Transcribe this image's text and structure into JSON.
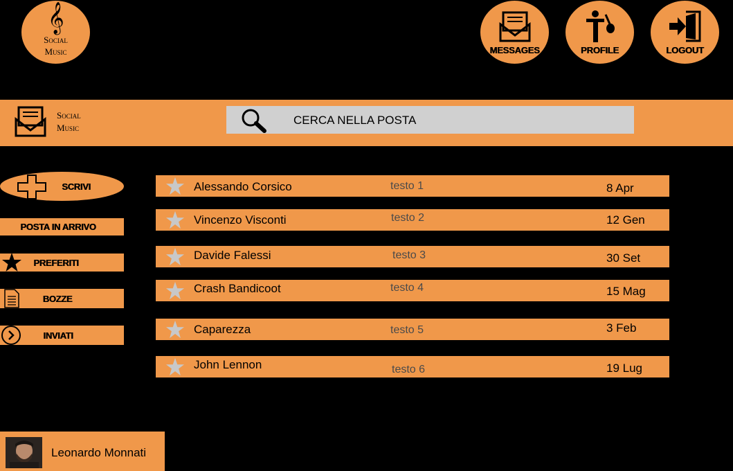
{
  "brand": {
    "line1": "Social",
    "line2": "Music",
    "logo_icon": "treble-clef-icon"
  },
  "top_nav": [
    {
      "label": "MESSAGES",
      "icon": "envelope-icon"
    },
    {
      "label": "PROFILE",
      "icon": "musician-icon"
    },
    {
      "label": "LOGOUT",
      "icon": "logout-door-icon"
    }
  ],
  "mail_bar": {
    "brand_line1": "Social",
    "brand_line2": "Music",
    "search_text": "CERCA NELLA POSTA"
  },
  "sidebar": {
    "compose": "SCRIVI",
    "items": [
      {
        "label": "POSTA IN ARRIVO",
        "icon": ""
      },
      {
        "label": "PREFERITI",
        "icon": "star-icon"
      },
      {
        "label": "BOZZE",
        "icon": "document-icon"
      },
      {
        "label": "INVIATI",
        "icon": "chevron-right-circle-icon"
      }
    ]
  },
  "messages": [
    {
      "sender": "Alessando Corsico",
      "subject": "testo 1",
      "date": "8 Apr"
    },
    {
      "sender": "Vincenzo Visconti",
      "subject": "testo 2",
      "date": "12 Gen"
    },
    {
      "sender": "Davide Falessi",
      "subject": "testo 3",
      "date": "30 Set"
    },
    {
      "sender": "Crash Bandicoot",
      "subject": "testo 4",
      "date": "15 Mag"
    },
    {
      "sender": "Caparezza",
      "subject": "testo 5",
      "date": "3 Feb"
    },
    {
      "sender": "John Lennon",
      "subject": "testo 6",
      "date": "19 Lug"
    }
  ],
  "user": {
    "name": "Leonardo Monnati"
  },
  "colors": {
    "accent": "#f0984a",
    "background": "#000000",
    "search_bg": "#d0d0d0",
    "star": "#c8c8c8"
  }
}
